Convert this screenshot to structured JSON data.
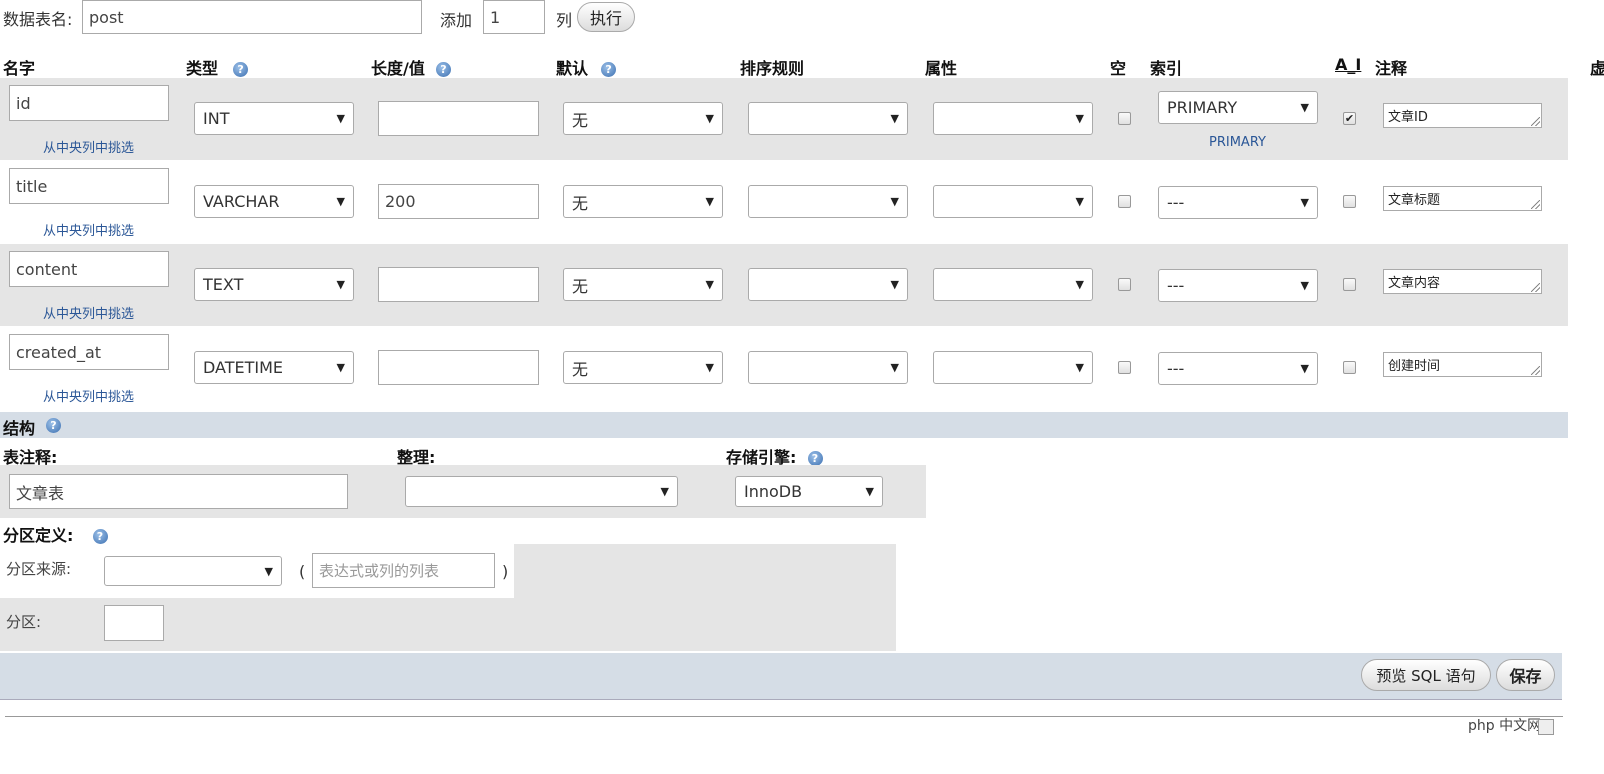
{
  "top": {
    "table_name_label": "数据表名:",
    "table_name_value": "post",
    "add_label": "添加",
    "add_count": "1",
    "column_label": "列",
    "execute_button": "执行"
  },
  "headers": {
    "name": "名字",
    "type": "类型",
    "length": "长度/值",
    "default": "默认",
    "collation": "排序规则",
    "attributes": "属性",
    "null": "空",
    "index": "索引",
    "ai": "A_I",
    "comment": "注释",
    "cut": "虚"
  },
  "pick_from_central": "从中央列中挑选",
  "rows": [
    {
      "name": "id",
      "type": "INT",
      "length": "",
      "default": "无",
      "collation": "",
      "attributes": "",
      "null": false,
      "index": "PRIMARY",
      "index_sub": "PRIMARY",
      "ai": true,
      "comment": "文章ID"
    },
    {
      "name": "title",
      "type": "VARCHAR",
      "length": "200",
      "default": "无",
      "collation": "",
      "attributes": "",
      "null": false,
      "index": "---",
      "index_sub": "",
      "ai": false,
      "comment": "文章标题"
    },
    {
      "name": "content",
      "type": "TEXT",
      "length": "",
      "default": "无",
      "collation": "",
      "attributes": "",
      "null": false,
      "index": "---",
      "index_sub": "",
      "ai": false,
      "comment": "文章内容"
    },
    {
      "name": "created_at",
      "type": "DATETIME",
      "length": "",
      "default": "无",
      "collation": "",
      "attributes": "",
      "null": false,
      "index": "---",
      "index_sub": "",
      "ai": false,
      "comment": " 创建时间"
    }
  ],
  "structure": {
    "title": "结构",
    "table_comment_label": "表注释:",
    "table_comment_value": "文章表",
    "collation_label": "整理:",
    "collation_value": "",
    "engine_label": "存储引擎:",
    "engine_value": "InnoDB"
  },
  "partition": {
    "title": "分区定义:",
    "source_label": "分区来源:",
    "source_value": "",
    "open_paren": "(",
    "expr_placeholder": "表达式或列的列表",
    "close_paren": ")",
    "partitions_label": "分区:",
    "partitions_value": ""
  },
  "footer": {
    "preview_sql": "预览 SQL 语句",
    "save": "保存"
  },
  "watermark": "php 中文网",
  "colors": {
    "row_grey": "#e5e5e5",
    "section_bar": "#d5dde6",
    "link": "#2b5797"
  }
}
